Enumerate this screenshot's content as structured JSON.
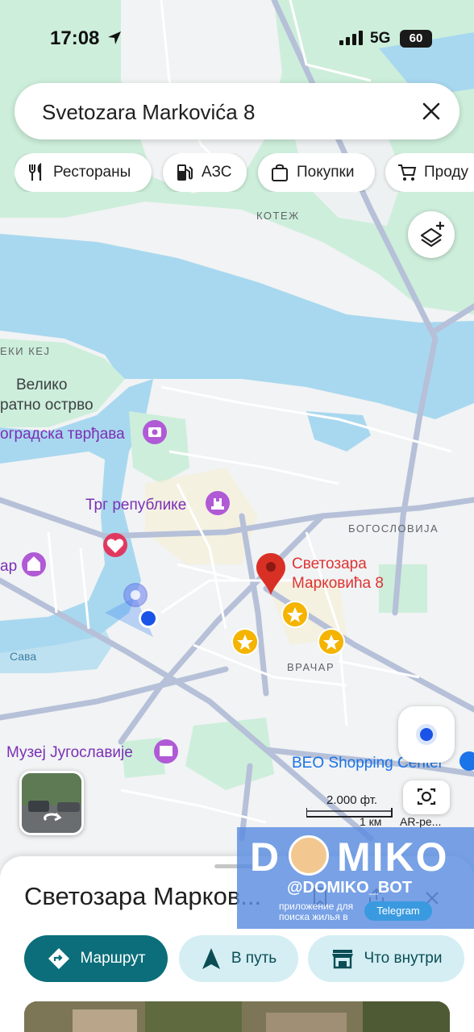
{
  "status_bar": {
    "time": "17:08",
    "network": "5G",
    "battery": "60"
  },
  "search": {
    "query": "Svetozara Markovića 8"
  },
  "chips": [
    {
      "label": "Рестораны",
      "icon": "restaurant-icon"
    },
    {
      "label": "АЗС",
      "icon": "gas-station-icon"
    },
    {
      "label": "Покупки",
      "icon": "shopping-bag-icon"
    },
    {
      "label": "Проду",
      "icon": "grocery-cart-icon"
    }
  ],
  "map": {
    "labels": {
      "kotezh": "КОТЕЖ",
      "keji": "ЕКИ КЕЈ",
      "veliko1": "Велико",
      "veliko2": "ратно острво",
      "tvrdjava": "оградска тврђава",
      "trg": "Трг републике",
      "bogoslovija": "БОГОСЛОВИЈА",
      "ar_edge": "ар",
      "sava": "Сава",
      "vracar": "ВРАЧАР",
      "muzej": "Музеј Југославије",
      "beo": "BEO Shopping Center",
      "pin_line1": "Светозара",
      "pin_line2": "Марковића 8"
    },
    "scale_ft": "2.000 фт.",
    "scale_km": "1 км",
    "ar_label": "AR-ре..."
  },
  "sheet": {
    "title": "Светозара Марков...",
    "actions": {
      "route": "Маршрут",
      "go": "В путь",
      "inside": "Что внутри"
    }
  },
  "banner": {
    "logo_left": "D",
    "logo_right": "MIKO",
    "handle": "@DOMIKO_BOT",
    "sub1": "приложение для",
    "sub2": "поиска жилья в",
    "telegram": "Telegram"
  },
  "colors": {
    "water": "#a8d8ef",
    "park": "#c8ebd5",
    "road": "#c5cde0",
    "pin": "#d93025",
    "accent": "#0b6e7a"
  }
}
